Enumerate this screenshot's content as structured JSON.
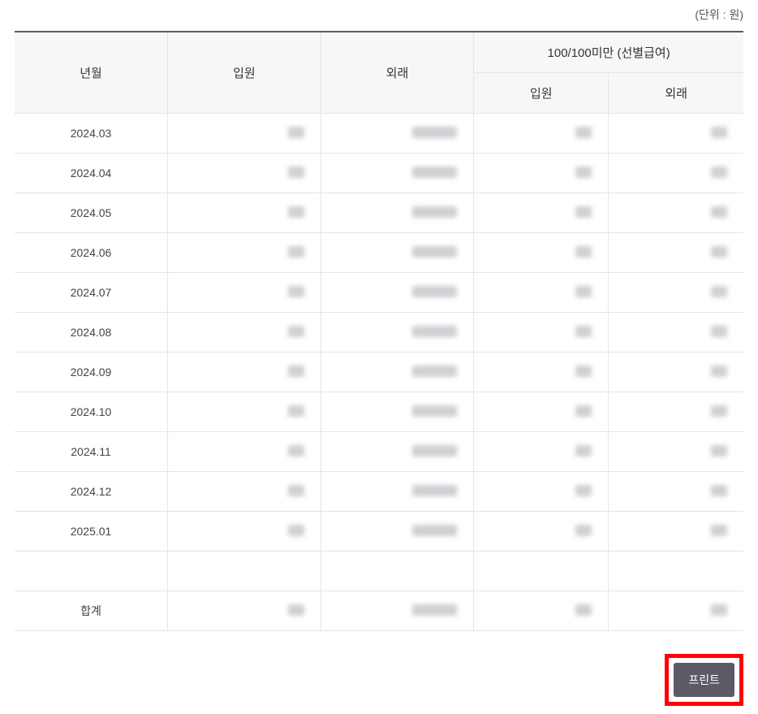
{
  "unit_label": "(단위 : 원)",
  "headers": {
    "month": "년월",
    "inpatient": "입원",
    "outpatient": "외래",
    "sub_group": "100/100미만 (선별급여)",
    "sub_inpatient": "입원",
    "sub_outpatient": "외래"
  },
  "rows": [
    {
      "month": "2024.03",
      "inpatient": "",
      "outpatient": "",
      "sub_inpatient": "",
      "sub_outpatient": ""
    },
    {
      "month": "2024.04",
      "inpatient": "",
      "outpatient": "",
      "sub_inpatient": "",
      "sub_outpatient": ""
    },
    {
      "month": "2024.05",
      "inpatient": "",
      "outpatient": "",
      "sub_inpatient": "",
      "sub_outpatient": ""
    },
    {
      "month": "2024.06",
      "inpatient": "",
      "outpatient": "",
      "sub_inpatient": "",
      "sub_outpatient": ""
    },
    {
      "month": "2024.07",
      "inpatient": "",
      "outpatient": "",
      "sub_inpatient": "",
      "sub_outpatient": ""
    },
    {
      "month": "2024.08",
      "inpatient": "",
      "outpatient": "",
      "sub_inpatient": "",
      "sub_outpatient": ""
    },
    {
      "month": "2024.09",
      "inpatient": "",
      "outpatient": "",
      "sub_inpatient": "",
      "sub_outpatient": ""
    },
    {
      "month": "2024.10",
      "inpatient": "",
      "outpatient": "",
      "sub_inpatient": "",
      "sub_outpatient": ""
    },
    {
      "month": "2024.11",
      "inpatient": "",
      "outpatient": "",
      "sub_inpatient": "",
      "sub_outpatient": ""
    },
    {
      "month": "2024.12",
      "inpatient": "",
      "outpatient": "",
      "sub_inpatient": "",
      "sub_outpatient": ""
    },
    {
      "month": "2025.01",
      "inpatient": "",
      "outpatient": "",
      "sub_inpatient": "",
      "sub_outpatient": ""
    }
  ],
  "total": {
    "label": "합계",
    "inpatient": "",
    "outpatient": "",
    "sub_inpatient": "",
    "sub_outpatient": ""
  },
  "buttons": {
    "print": "프린트"
  }
}
